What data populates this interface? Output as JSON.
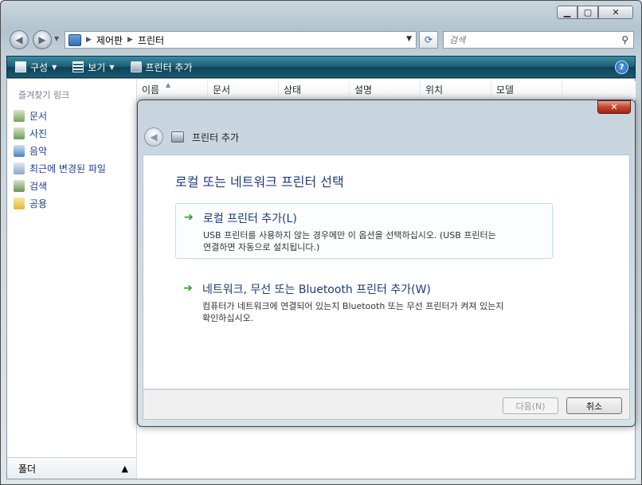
{
  "window": {
    "caption_minimize": "▁",
    "caption_maximize": "▢",
    "caption_close": "✕"
  },
  "address": {
    "crumbs": [
      "제어판",
      "프린터"
    ]
  },
  "search": {
    "placeholder": "검색"
  },
  "toolbar": {
    "organize": "구성",
    "views": "보기",
    "add_printer": "프린터 추가",
    "help": "?"
  },
  "nav_pane": {
    "title": "즐겨찾기 링크",
    "items": [
      "문서",
      "사진",
      "음악",
      "최근에 변경된 파일",
      "검색",
      "공용"
    ],
    "folders_label": "폴더"
  },
  "columns": [
    "이름",
    "문서",
    "상태",
    "설명",
    "위치",
    "모델"
  ],
  "dialog": {
    "title": "프린터 추가",
    "heading": "로컬 또는 네트워크 프린터 선택",
    "options": [
      {
        "title": "로컬 프린터 추가(L)",
        "desc_line1": "USB 프린터를 사용하지 않는 경우에만 이 옵션을 선택하십시오. (USB 프린터는",
        "desc_line2": "연결하면 자동으로 설치됩니다.)"
      },
      {
        "title": "네트워크, 무선 또는 Bluetooth 프린터 추가(W)",
        "desc_line1": "컴퓨터가 네트워크에 연결되어 있는지 Bluetooth 또는 무선 프린터가 켜져 있는지",
        "desc_line2": "확인하십시오."
      }
    ],
    "next_button": "다음(N)",
    "cancel_button": "취소"
  },
  "colors": {
    "heading_blue": "#1e3a7b",
    "toolbar_teal": "#1d5e75",
    "arrow_green": "#2c9e2f"
  }
}
